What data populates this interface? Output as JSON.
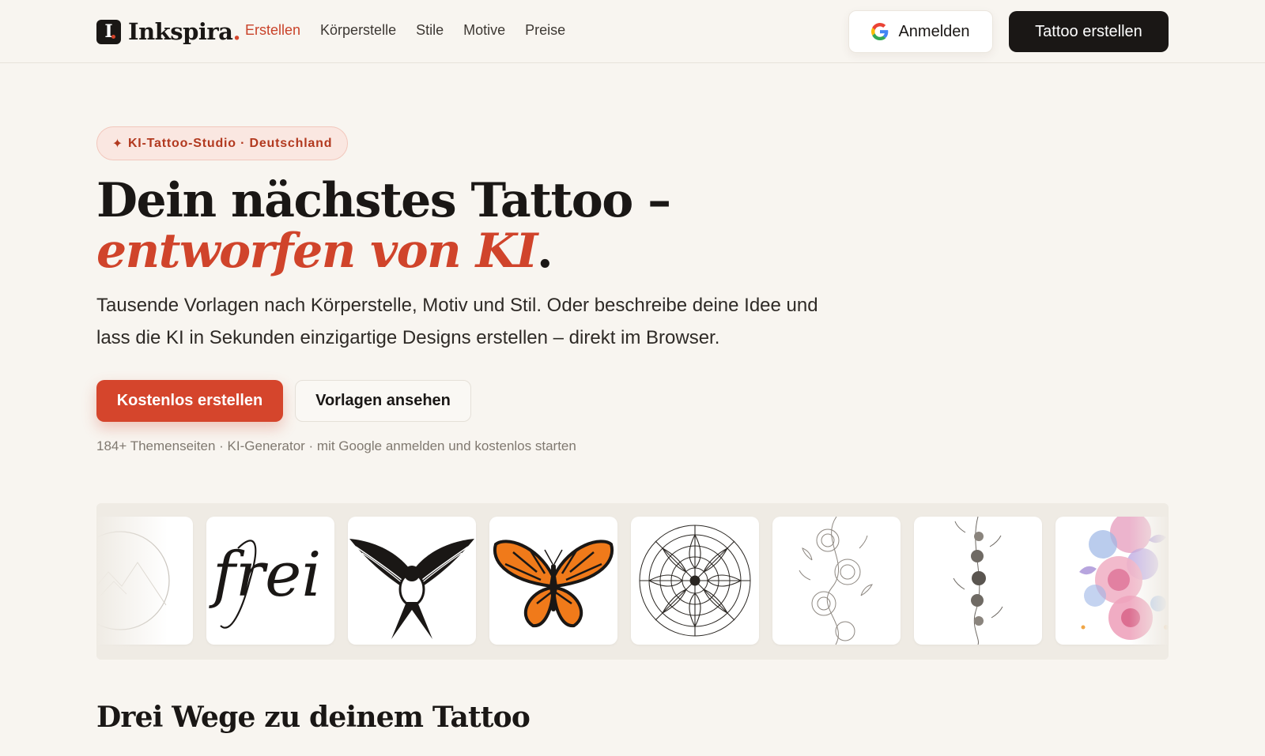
{
  "brand": {
    "name": "Inkspira",
    "dot": ".",
    "mark": "I"
  },
  "nav": {
    "items": [
      {
        "label": "Erstellen",
        "active": true
      },
      {
        "label": "Körperstelle",
        "active": false
      },
      {
        "label": "Stile",
        "active": false
      },
      {
        "label": "Motive",
        "active": false
      },
      {
        "label": "Preise",
        "active": false
      }
    ]
  },
  "header": {
    "login_label": "Anmelden",
    "cta_label": "Tattoo erstellen",
    "login_icon": "google-icon"
  },
  "hero": {
    "badge_icon": "✦",
    "badge": "KI-Tattoo-Studio · Deutschland",
    "title_line1": "Dein nächstes Tattoo –",
    "title_line2_em": "entworfen von KI",
    "title_line2_end": ".",
    "lead": "Tausende Vorlagen nach Körperstelle, Motiv und Stil. Oder beschreibe deine Idee und lass die KI in Sekunden einzigartige Designs erstellen – direkt im Browser.",
    "primary_cta": "Kostenlos erstellen",
    "secondary_cta": "Vorlagen ansehen",
    "meta": "184+ Themenseiten · KI-Generator · mit Google anmelden und kostenlos starten"
  },
  "gallery": {
    "items": [
      {
        "icon": "mountain-circle-tattoo-icon"
      },
      {
        "icon": "script-frei-tattoo-icon",
        "text": "frei"
      },
      {
        "icon": "swallow-tattoo-icon"
      },
      {
        "icon": "butterfly-tattoo-icon"
      },
      {
        "icon": "mandala-tattoo-icon"
      },
      {
        "icon": "rose-vine-tattoo-icon"
      },
      {
        "icon": "moon-phases-tattoo-icon"
      },
      {
        "icon": "watercolor-flowers-tattoo-icon"
      }
    ]
  },
  "section": {
    "title": "Drei Wege zu deinem Tattoo"
  },
  "colors": {
    "accent": "#d5452c",
    "dark": "#1a1715",
    "background": "#f8f5f0"
  }
}
